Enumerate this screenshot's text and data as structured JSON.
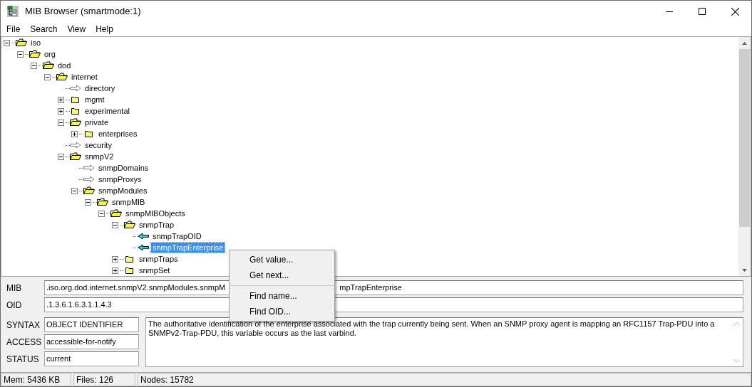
{
  "window": {
    "title": "MIB Browser (smartmode:1)"
  },
  "menu_bar": [
    "File",
    "Search",
    "View",
    "Help"
  ],
  "tree": [
    {
      "label": "iso",
      "kind": "folder",
      "expanded": true,
      "selected": false,
      "children": [
        {
          "label": "org",
          "kind": "folder",
          "expanded": true,
          "selected": false,
          "children": [
            {
              "label": "dod",
              "kind": "folder",
              "expanded": true,
              "selected": false,
              "children": [
                {
                  "label": "internet",
                  "kind": "folder",
                  "expanded": true,
                  "selected": false,
                  "children": [
                    {
                      "label": "directory",
                      "kind": "node",
                      "selected": false
                    },
                    {
                      "label": "mgmt",
                      "kind": "folder",
                      "expanded": false,
                      "selected": false
                    },
                    {
                      "label": "experimental",
                      "kind": "folder",
                      "expanded": false,
                      "selected": false
                    },
                    {
                      "label": "private",
                      "kind": "folder",
                      "expanded": true,
                      "selected": false,
                      "children": [
                        {
                          "label": "enterprises",
                          "kind": "folder",
                          "expanded": false,
                          "selected": false
                        }
                      ]
                    },
                    {
                      "label": "security",
                      "kind": "node",
                      "selected": false
                    },
                    {
                      "label": "snmpV2",
                      "kind": "folder",
                      "expanded": true,
                      "selected": false,
                      "children": [
                        {
                          "label": "snmpDomains",
                          "kind": "node",
                          "selected": false
                        },
                        {
                          "label": "snmpProxys",
                          "kind": "node",
                          "selected": false
                        },
                        {
                          "label": "snmpModules",
                          "kind": "folder",
                          "expanded": true,
                          "selected": false,
                          "children": [
                            {
                              "label": "snmpMIB",
                              "kind": "folder",
                              "expanded": true,
                              "selected": false,
                              "children": [
                                {
                                  "label": "snmpMIBObjects",
                                  "kind": "folder",
                                  "expanded": true,
                                  "selected": false,
                                  "children": [
                                    {
                                      "label": "snmpTrap",
                                      "kind": "folder",
                                      "expanded": true,
                                      "selected": false,
                                      "children": [
                                        {
                                          "label": "snmpTrapOID",
                                          "kind": "notification",
                                          "selected": false
                                        },
                                        {
                                          "label": "snmpTrapEnterprise",
                                          "kind": "notification",
                                          "selected": true
                                        }
                                      ]
                                    },
                                    {
                                      "label": "snmpTraps",
                                      "kind": "folder",
                                      "expanded": false,
                                      "selected": false
                                    },
                                    {
                                      "label": "snmpSet",
                                      "kind": "folder",
                                      "expanded": false,
                                      "selected": false
                                    }
                                  ]
                                }
                              ]
                            }
                          ]
                        }
                      ]
                    }
                  ]
                }
              ]
            }
          ]
        }
      ]
    }
  ],
  "context_menu": [
    {
      "label": "Get value...",
      "separator_after": false
    },
    {
      "label": "Get next...",
      "separator_after": true
    },
    {
      "label": "Find name...",
      "separator_after": false
    },
    {
      "label": "Find OID...",
      "separator_after": false
    }
  ],
  "details": {
    "mib": {
      "label": "MIB",
      "value_left": ".iso.org.dod.internet.snmpV2.snmpModules.snmpM",
      "value_right": "mpTrapEnterprise"
    },
    "oid": {
      "label": "OID",
      "value": ".1.3.6.1.6.3.1.1.4.3"
    },
    "syntax": {
      "label": "SYNTAX",
      "value": "OBJECT IDENTIFIER"
    },
    "access": {
      "label": "ACCESS",
      "value": "accessible-for-notify"
    },
    "status": {
      "label": "STATUS",
      "value": "current"
    },
    "description": "The authoritative identification of the enterprise associated with the trap currently being sent.  When an SNMP proxy agent is mapping an RFC1157 Trap-PDU into a SNMPv2-Trap-PDU, this variable occurs as the last varbind."
  },
  "status_bar": [
    "Mem: 5436 KB",
    "Files: 126",
    "Nodes: 15782"
  ]
}
